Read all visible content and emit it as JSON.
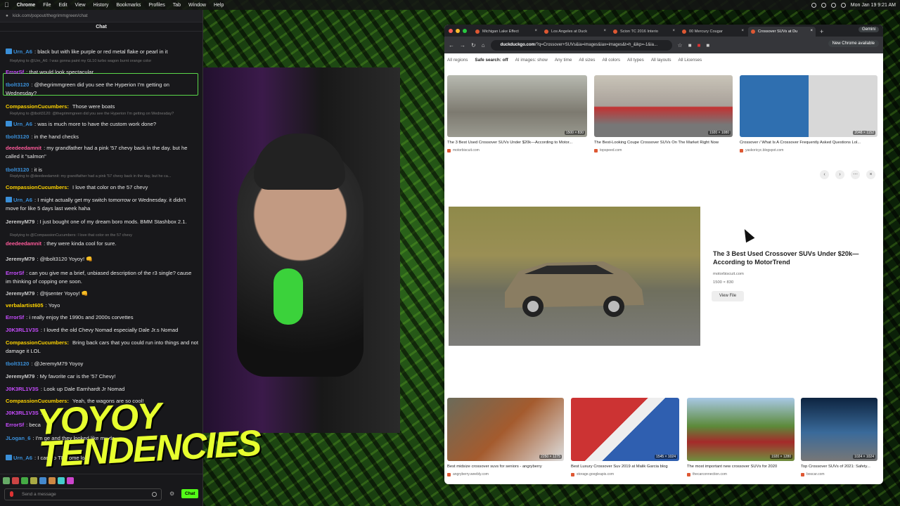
{
  "menubar": {
    "app": "Chrome",
    "items": [
      "File",
      "Edit",
      "View",
      "History",
      "Bookmarks",
      "Profiles",
      "Tab",
      "Window",
      "Help"
    ],
    "datetime": "Mon Jan 19  9:21 AM"
  },
  "chat": {
    "url": "kick.com/popout/thegrimmgreen/chat",
    "title": "Chat",
    "send_placeholder": "Send a message",
    "chat_button": "Chat",
    "replies": [
      "Replying to @Urn_A6: I was gonna paint my GL10 turbo wagon burnt orange color",
      "Replying to @tbolt3120: @thegrimmgreen did you see the Hyperion I'm getting on Wednesday?",
      "Replying to @deedeedamnit: my grandfather had a pink '57 chevy back in the day, but he ca...",
      "Replying to @CompassionCucumbers: I love that color on the 57 chevy"
    ],
    "messages": [
      {
        "user": "Urn_A6",
        "color": "#3a8fd8",
        "text": "black but with like purple or red metal flake or pearl in it"
      },
      {
        "user": "ErrorSf",
        "color": "#c74cff",
        "text": "that would look spectacular"
      },
      {
        "user": "tbolt3120",
        "color": "#3a8fd8",
        "text": "@thegrimmgreen did you see the Hyperion I'm getting on Wednesday?"
      },
      {
        "user": "CompassionCucumbers:",
        "color": "#ffd400",
        "text": "Those were boats"
      },
      {
        "user": "Urn_A6",
        "color": "#3a8fd8",
        "text": "was is much more to have the custom work done?"
      },
      {
        "user": "tbolt3120",
        "color": "#3a8fd8",
        "text": "in the hand checks"
      },
      {
        "user": "deedeedamnit",
        "color": "#ff5a9a",
        "text": "my grandfather had a pink '57 chevy back in the day. but he called it \"salmon\""
      },
      {
        "user": "tbolt3120",
        "color": "#3a8fd8",
        "text": "it is"
      },
      {
        "user": "CompassionCucumbers:",
        "color": "#ffd400",
        "text": "I love that color on the 57 chevy"
      },
      {
        "user": "Urn_A6",
        "color": "#3a8fd8",
        "text": "I might actually get my switch tomorrow or Wednesday. it didn't move for like 5 days last week haha"
      },
      {
        "user": "JeremyM79",
        "color": "#cfcfcf",
        "text": "I just bought one of my dream boro mods. BMM Stashbox 2.1."
      },
      {
        "user": "deedeedamnit",
        "color": "#ff5a9a",
        "text": "they were kinda cool for sure."
      },
      {
        "user": "JeremyM79",
        "color": "#cfcfcf",
        "text": "@tbolt3120 Yoyoy! 👊"
      },
      {
        "user": "ErrorSf",
        "color": "#c74cff",
        "text": "can you give me a brief, unbiased description of the r3 single? cause im thinking of copping one soon."
      },
      {
        "user": "JeremyM79",
        "color": "#cfcfcf",
        "text": "@tjsenter Yoyoy! 👊"
      },
      {
        "user": "verbalartist605",
        "color": "#ffd400",
        "text": "Yoyo"
      },
      {
        "user": "ErrorSf",
        "color": "#c74cff",
        "text": "i really enjoy the 1990s and 2000s corvettes"
      },
      {
        "user": "J0K3RL1V3S",
        "color": "#c74cff",
        "text": "I loved the old Chevy Nomad especially Dale Jr.s Nomad"
      },
      {
        "user": "CompassionCucumbers:",
        "color": "#ffd400",
        "text": "Bring back cars that you could run into things and not damage it LOL"
      },
      {
        "user": "tbolt3120",
        "color": "#3a8fd8",
        "text": "@JeremyM79 Yoyoy"
      },
      {
        "user": "JeremyM79",
        "color": "#cfcfcf",
        "text": "My favorite car is the '57 Chevy!"
      },
      {
        "user": "J0K3RL1V3S",
        "color": "#c74cff",
        "text": "Look up Dale Earnhardt Jr Nomad"
      },
      {
        "user": "CompassionCucumbers:",
        "color": "#ffd400",
        "text": "Yeah, the wagons are so cool!"
      },
      {
        "user": "J0K3RL1V3S",
        "color": "#c74cff",
        "text": "Y"
      },
      {
        "user": "ErrorSf",
        "color": "#c74cff",
        "text": "beca"
      },
      {
        "user": "JLogan_6",
        "color": "#3a8fd8",
        "text": "I'm ge                                          and they looked like my da"
      },
      {
        "user": "Urn_A6",
        "color": "#3a8fd8",
        "text": "                                              I can go TF home lol"
      }
    ]
  },
  "overlay": {
    "text": "YOYOY\nTENDENCIES"
  },
  "browser": {
    "tabs": [
      "Michigan Lake Effect",
      "Los Angeles at Duck",
      "Scion TC 2016 Interio",
      "00 Mercury Cougar",
      "Crossover SUVs at Du"
    ],
    "gemini": "Gemini",
    "url": "duckduckgo.com",
    "url_rest": "/?q=Crossover+SUVs&ia=images&iax=images&t=h_&ikp=-1&ia...",
    "chrome_available": "New Chrome available",
    "filters": [
      "All regions",
      "Safe search: off",
      "AI images: show",
      "Any time",
      "All sizes",
      "All colors",
      "All types",
      "All layouts",
      "All Licenses"
    ],
    "top_results": [
      {
        "caption": "The 3 Best Used Crossover SUVs Under $20k—According to Motor...",
        "source": "motorbiscuit.com",
        "dims": "1500 × 830"
      },
      {
        "caption": "The Best-Looking Coupe Crossover SUVs On The Market Right Now",
        "source": "topspeed.com",
        "dims": "1920 × 1080"
      },
      {
        "caption": "Crossover / What Is A Crossover Frequently Asked Questions Lol...",
        "source": "yaskoricyc.blogspot.com",
        "dims": "2048 × 1152"
      }
    ],
    "detail": {
      "title": "The 3 Best Used Crossover SUVs Under $20k—According to MotorTrend",
      "source": "motorbiscuit.com",
      "dims": "1500 × 830",
      "view_file": "View File"
    },
    "bottom_results": [
      {
        "caption": "Best midsize crossover suvs for seniors - angryberry",
        "source": "angryberry.weebly.com",
        "dims": "2250 × 1275"
      },
      {
        "caption": "Best Luxury Crossover Suv 2019 at Malik Garcia blog",
        "source": "storage.googleapis.com",
        "dims": "1545 × 1024"
      },
      {
        "caption": "The most important new crossover SUVs for 2020",
        "source": "thecarconnection.com",
        "dims": "1920 × 1280"
      },
      {
        "caption": "Top Crossover SUVs of 2021: Safety...",
        "source": "boscar.com",
        "dims": "1024 × 1024"
      }
    ]
  }
}
